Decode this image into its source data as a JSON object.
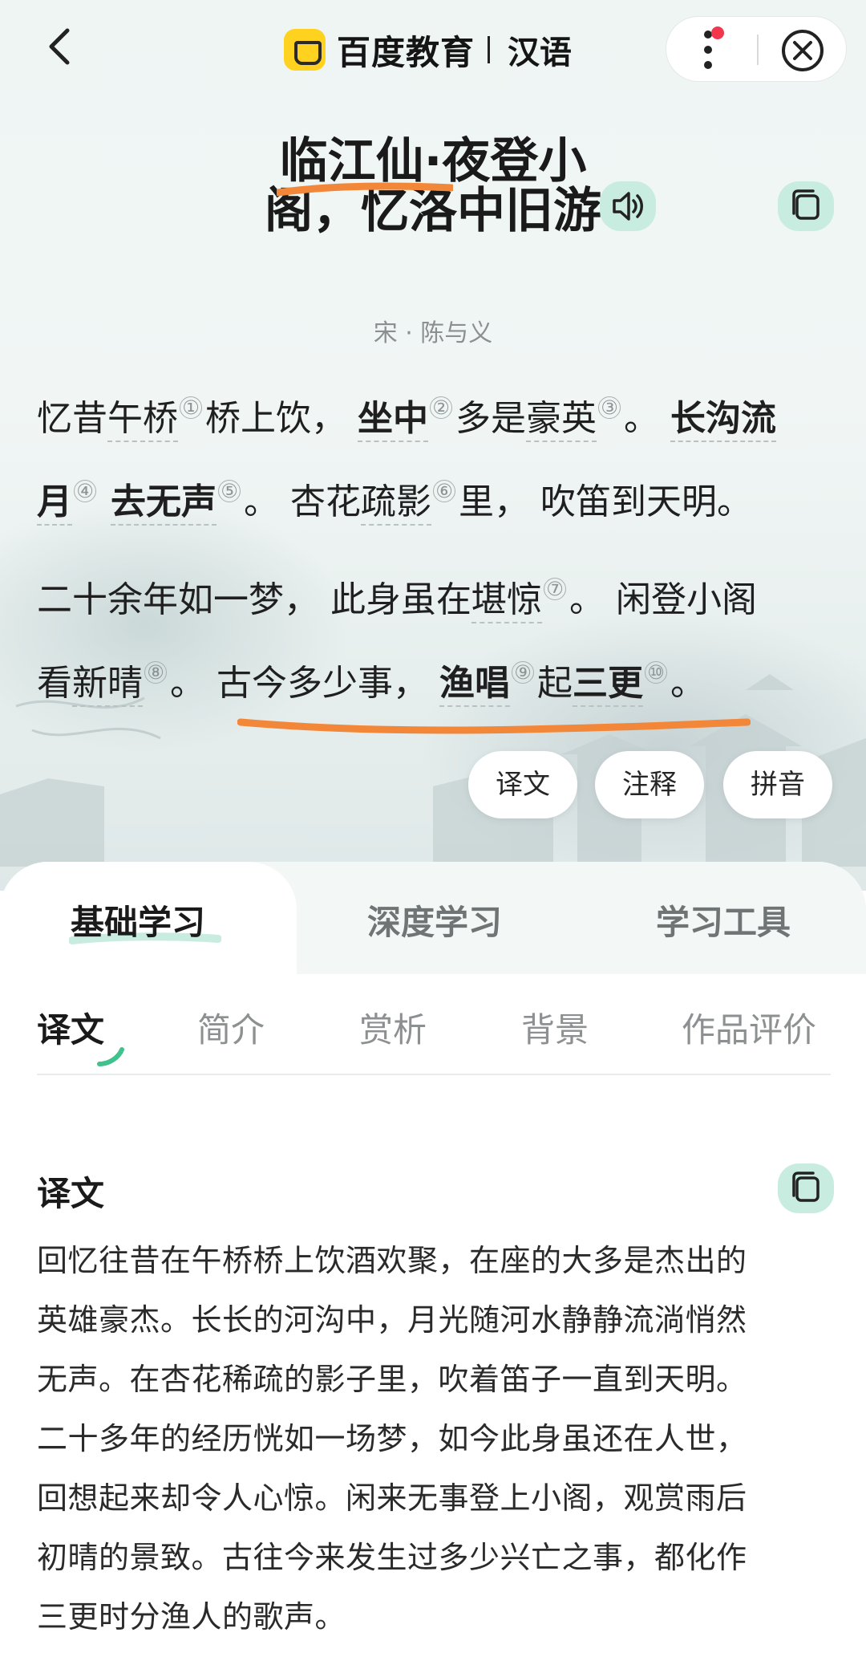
{
  "topbar": {
    "brand": "百度教育",
    "subtitle": "汉语"
  },
  "poem": {
    "title": "临江仙·夜登小阁，忆洛中旧游",
    "author": "宋 · 陈与义",
    "markers": [
      "①",
      "②",
      "③",
      "④",
      "⑤",
      "⑥",
      "⑦",
      "⑧",
      "⑨",
      "⑩"
    ],
    "line1": {
      "t1": "忆昔",
      "w1": "午桥",
      "t2": "桥上饮，",
      "w2": "坐中",
      "t3": "多是",
      "w3": "豪英",
      "t4": "。",
      "w4": "长沟流"
    },
    "line2": {
      "w1": "月",
      "w2": "去无声",
      "t1": "。",
      "t2": "杏花",
      "w3": "疏影",
      "t3": "里，",
      "t4": "吹笛到天明。"
    },
    "line3": {
      "t1": "二十余年如一梦，",
      "t2": "此身虽在",
      "w1": "堪惊",
      "t3": "。",
      "t4": "闲登小阁"
    },
    "line4": {
      "t1": "看",
      "w1": "新晴",
      "t2": "。",
      "t3": "古今多少事，",
      "w2": "渔唱",
      "t4": "起",
      "w3": "三更",
      "t5": "。"
    }
  },
  "actions": [
    "译文",
    "注释",
    "拼音"
  ],
  "tabs_main": [
    "基础学习",
    "深度学习",
    "学习工具"
  ],
  "tabs_sub": [
    "译文",
    "简介",
    "赏析",
    "背景",
    "作品评价"
  ],
  "section": {
    "title": "译文",
    "lines": [
      "回忆往昔在午桥桥上饮酒欢聚，在座的大多是杰出的",
      "英雄豪杰。长长的河沟中，月光随河水静静流淌悄然",
      "无声。在杏花稀疏的影子里，吹着笛子一直到天明。",
      "二十多年的经历恍如一场梦，如今此身虽还在人世，",
      "回想起来却令人心惊。闲来无事登上小阁，观赏雨后",
      "初晴的景致。古往今来发生过多少兴亡之事，都化作",
      "三更时分渔人的歌声。"
    ]
  },
  "colors": {
    "accent": "#c9ece1",
    "highlight": "#f2873a",
    "tab_deco": "#3fc28b"
  },
  "icons": [
    "back-arrow-icon",
    "more-dots-icon",
    "close-icon",
    "speaker-icon",
    "copy-icon"
  ]
}
